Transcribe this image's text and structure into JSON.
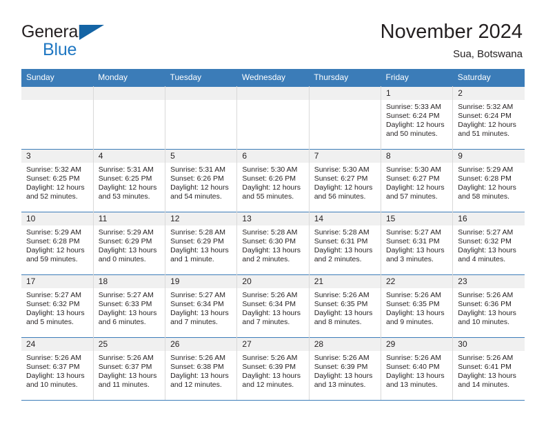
{
  "brand": {
    "name_top": "General",
    "name_bottom": "Blue",
    "triangle_color": "#1464a5",
    "blue_color": "#1f77c2"
  },
  "header": {
    "title": "November 2024",
    "subtitle": "Sua, Botswana"
  },
  "theme": {
    "header_row_bg": "#3b7cb8",
    "daynum_band_bg": "#f0f0f0",
    "text_color": "#231f20",
    "cell_divider": "#d9d9d9"
  },
  "weekday_headers": [
    "Sunday",
    "Monday",
    "Tuesday",
    "Wednesday",
    "Thursday",
    "Friday",
    "Saturday"
  ],
  "weeks": [
    [
      {
        "day": "",
        "lines": []
      },
      {
        "day": "",
        "lines": []
      },
      {
        "day": "",
        "lines": []
      },
      {
        "day": "",
        "lines": []
      },
      {
        "day": "",
        "lines": []
      },
      {
        "day": "1",
        "lines": [
          "Sunrise: 5:33 AM",
          "Sunset: 6:24 PM",
          "Daylight: 12 hours",
          "and 50 minutes."
        ]
      },
      {
        "day": "2",
        "lines": [
          "Sunrise: 5:32 AM",
          "Sunset: 6:24 PM",
          "Daylight: 12 hours",
          "and 51 minutes."
        ]
      }
    ],
    [
      {
        "day": "3",
        "lines": [
          "Sunrise: 5:32 AM",
          "Sunset: 6:25 PM",
          "Daylight: 12 hours",
          "and 52 minutes."
        ]
      },
      {
        "day": "4",
        "lines": [
          "Sunrise: 5:31 AM",
          "Sunset: 6:25 PM",
          "Daylight: 12 hours",
          "and 53 minutes."
        ]
      },
      {
        "day": "5",
        "lines": [
          "Sunrise: 5:31 AM",
          "Sunset: 6:26 PM",
          "Daylight: 12 hours",
          "and 54 minutes."
        ]
      },
      {
        "day": "6",
        "lines": [
          "Sunrise: 5:30 AM",
          "Sunset: 6:26 PM",
          "Daylight: 12 hours",
          "and 55 minutes."
        ]
      },
      {
        "day": "7",
        "lines": [
          "Sunrise: 5:30 AM",
          "Sunset: 6:27 PM",
          "Daylight: 12 hours",
          "and 56 minutes."
        ]
      },
      {
        "day": "8",
        "lines": [
          "Sunrise: 5:30 AM",
          "Sunset: 6:27 PM",
          "Daylight: 12 hours",
          "and 57 minutes."
        ]
      },
      {
        "day": "9",
        "lines": [
          "Sunrise: 5:29 AM",
          "Sunset: 6:28 PM",
          "Daylight: 12 hours",
          "and 58 minutes."
        ]
      }
    ],
    [
      {
        "day": "10",
        "lines": [
          "Sunrise: 5:29 AM",
          "Sunset: 6:28 PM",
          "Daylight: 12 hours",
          "and 59 minutes."
        ]
      },
      {
        "day": "11",
        "lines": [
          "Sunrise: 5:29 AM",
          "Sunset: 6:29 PM",
          "Daylight: 13 hours",
          "and 0 minutes."
        ]
      },
      {
        "day": "12",
        "lines": [
          "Sunrise: 5:28 AM",
          "Sunset: 6:29 PM",
          "Daylight: 13 hours",
          "and 1 minute."
        ]
      },
      {
        "day": "13",
        "lines": [
          "Sunrise: 5:28 AM",
          "Sunset: 6:30 PM",
          "Daylight: 13 hours",
          "and 2 minutes."
        ]
      },
      {
        "day": "14",
        "lines": [
          "Sunrise: 5:28 AM",
          "Sunset: 6:31 PM",
          "Daylight: 13 hours",
          "and 2 minutes."
        ]
      },
      {
        "day": "15",
        "lines": [
          "Sunrise: 5:27 AM",
          "Sunset: 6:31 PM",
          "Daylight: 13 hours",
          "and 3 minutes."
        ]
      },
      {
        "day": "16",
        "lines": [
          "Sunrise: 5:27 AM",
          "Sunset: 6:32 PM",
          "Daylight: 13 hours",
          "and 4 minutes."
        ]
      }
    ],
    [
      {
        "day": "17",
        "lines": [
          "Sunrise: 5:27 AM",
          "Sunset: 6:32 PM",
          "Daylight: 13 hours",
          "and 5 minutes."
        ]
      },
      {
        "day": "18",
        "lines": [
          "Sunrise: 5:27 AM",
          "Sunset: 6:33 PM",
          "Daylight: 13 hours",
          "and 6 minutes."
        ]
      },
      {
        "day": "19",
        "lines": [
          "Sunrise: 5:27 AM",
          "Sunset: 6:34 PM",
          "Daylight: 13 hours",
          "and 7 minutes."
        ]
      },
      {
        "day": "20",
        "lines": [
          "Sunrise: 5:26 AM",
          "Sunset: 6:34 PM",
          "Daylight: 13 hours",
          "and 7 minutes."
        ]
      },
      {
        "day": "21",
        "lines": [
          "Sunrise: 5:26 AM",
          "Sunset: 6:35 PM",
          "Daylight: 13 hours",
          "and 8 minutes."
        ]
      },
      {
        "day": "22",
        "lines": [
          "Sunrise: 5:26 AM",
          "Sunset: 6:35 PM",
          "Daylight: 13 hours",
          "and 9 minutes."
        ]
      },
      {
        "day": "23",
        "lines": [
          "Sunrise: 5:26 AM",
          "Sunset: 6:36 PM",
          "Daylight: 13 hours",
          "and 10 minutes."
        ]
      }
    ],
    [
      {
        "day": "24",
        "lines": [
          "Sunrise: 5:26 AM",
          "Sunset: 6:37 PM",
          "Daylight: 13 hours",
          "and 10 minutes."
        ]
      },
      {
        "day": "25",
        "lines": [
          "Sunrise: 5:26 AM",
          "Sunset: 6:37 PM",
          "Daylight: 13 hours",
          "and 11 minutes."
        ]
      },
      {
        "day": "26",
        "lines": [
          "Sunrise: 5:26 AM",
          "Sunset: 6:38 PM",
          "Daylight: 13 hours",
          "and 12 minutes."
        ]
      },
      {
        "day": "27",
        "lines": [
          "Sunrise: 5:26 AM",
          "Sunset: 6:39 PM",
          "Daylight: 13 hours",
          "and 12 minutes."
        ]
      },
      {
        "day": "28",
        "lines": [
          "Sunrise: 5:26 AM",
          "Sunset: 6:39 PM",
          "Daylight: 13 hours",
          "and 13 minutes."
        ]
      },
      {
        "day": "29",
        "lines": [
          "Sunrise: 5:26 AM",
          "Sunset: 6:40 PM",
          "Daylight: 13 hours",
          "and 13 minutes."
        ]
      },
      {
        "day": "30",
        "lines": [
          "Sunrise: 5:26 AM",
          "Sunset: 6:41 PM",
          "Daylight: 13 hours",
          "and 14 minutes."
        ]
      }
    ]
  ]
}
